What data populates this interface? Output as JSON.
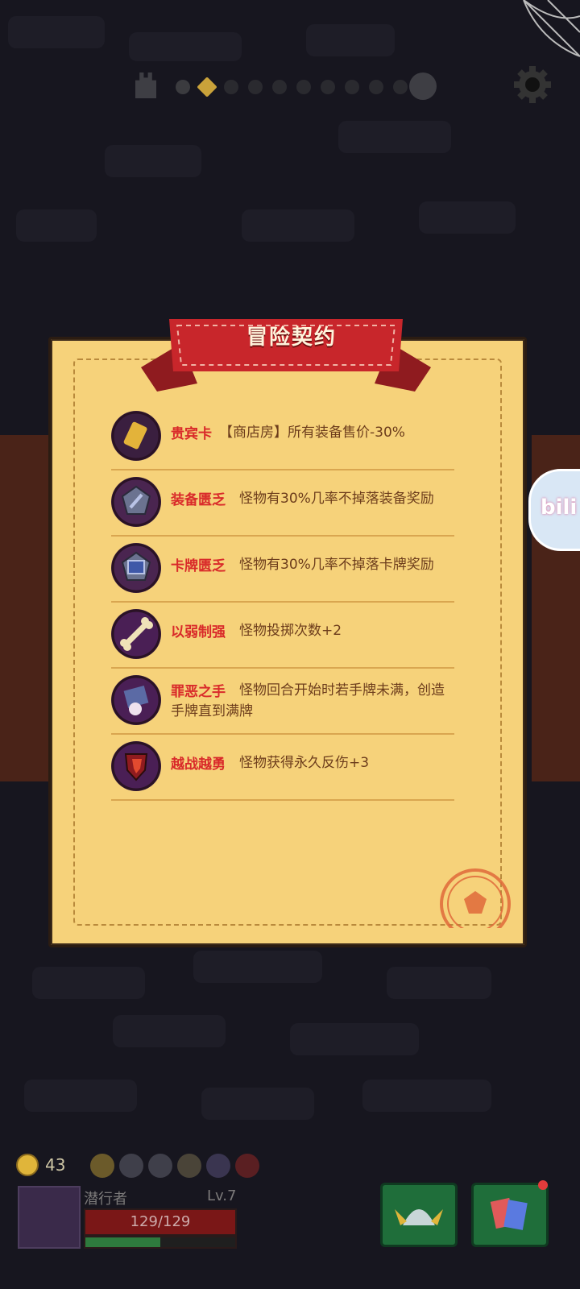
{
  "top_progress": {
    "start_label": "",
    "boss_label": ""
  },
  "contract": {
    "title": "冒险契约",
    "items": [
      {
        "name": "贵宾卡",
        "desc": "【商店房】所有装备售价-30%"
      },
      {
        "name": "装备匮乏",
        "desc": "怪物有30%几率不掉落装备奖励"
      },
      {
        "name": "卡牌匮乏",
        "desc": "怪物有30%几率不掉落卡牌奖励"
      },
      {
        "name": "以弱制强",
        "desc": "怪物投掷次数+2"
      },
      {
        "name": "罪恶之手",
        "desc": "怪物回合开始时若手牌未满，创造手牌直到满牌"
      },
      {
        "name": "越战越勇",
        "desc": "怪物获得永久反伤+3"
      }
    ]
  },
  "hud": {
    "coins": "43",
    "player_name": "潜行者",
    "level": "Lv.7",
    "hp": "129/129",
    "exp_fraction": 0.5
  },
  "bili_badge": "bili",
  "colors": {
    "scroll": "#f6d27a",
    "ribbon": "#c8262b",
    "item_name": "#d92a2a",
    "item_desc": "#6d3d1c"
  }
}
